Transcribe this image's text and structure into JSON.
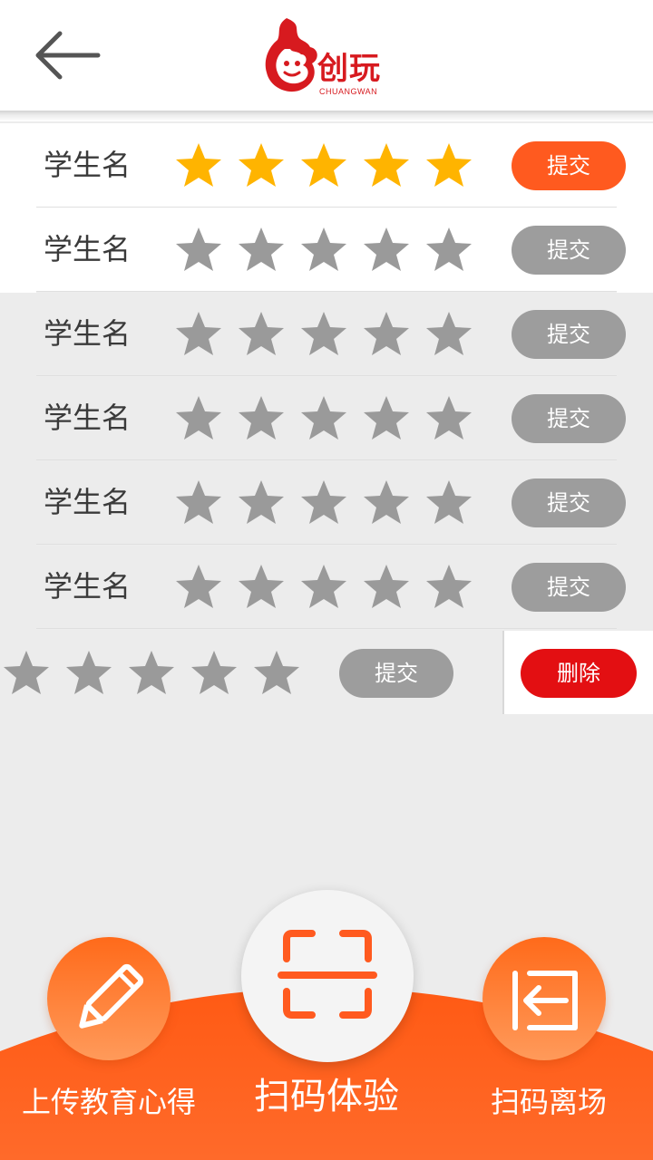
{
  "header": {
    "back_icon": "arrow-left-icon",
    "logo_text": "创玩",
    "logo_sub": "CHUANGWAN"
  },
  "colors": {
    "accent": "#ff5a1f",
    "star_active": "#ffb400",
    "star_inactive": "#9a9a9a",
    "button_inactive": "#9d9d9d",
    "delete": "#e30f12"
  },
  "students": [
    {
      "name": "学生名",
      "rating": 5,
      "submit_label": "提交",
      "active": true
    },
    {
      "name": "学生名",
      "rating": 0,
      "submit_label": "提交",
      "active": false
    },
    {
      "name": "学生名",
      "rating": 0,
      "submit_label": "提交",
      "active": false
    },
    {
      "name": "学生名",
      "rating": 0,
      "submit_label": "提交",
      "active": false
    },
    {
      "name": "学生名",
      "rating": 0,
      "submit_label": "提交",
      "active": false
    },
    {
      "name": "学生名",
      "rating": 0,
      "submit_label": "提交",
      "active": false
    }
  ],
  "swiped_row": {
    "rating": 0,
    "submit_label": "提交",
    "delete_label": "删除"
  },
  "bottom_nav": {
    "left": {
      "label": "上传教育心得",
      "icon": "pencil-icon"
    },
    "center": {
      "label": "扫码体验",
      "icon": "scan-icon"
    },
    "right": {
      "label": "扫码离场",
      "icon": "exit-icon"
    }
  }
}
